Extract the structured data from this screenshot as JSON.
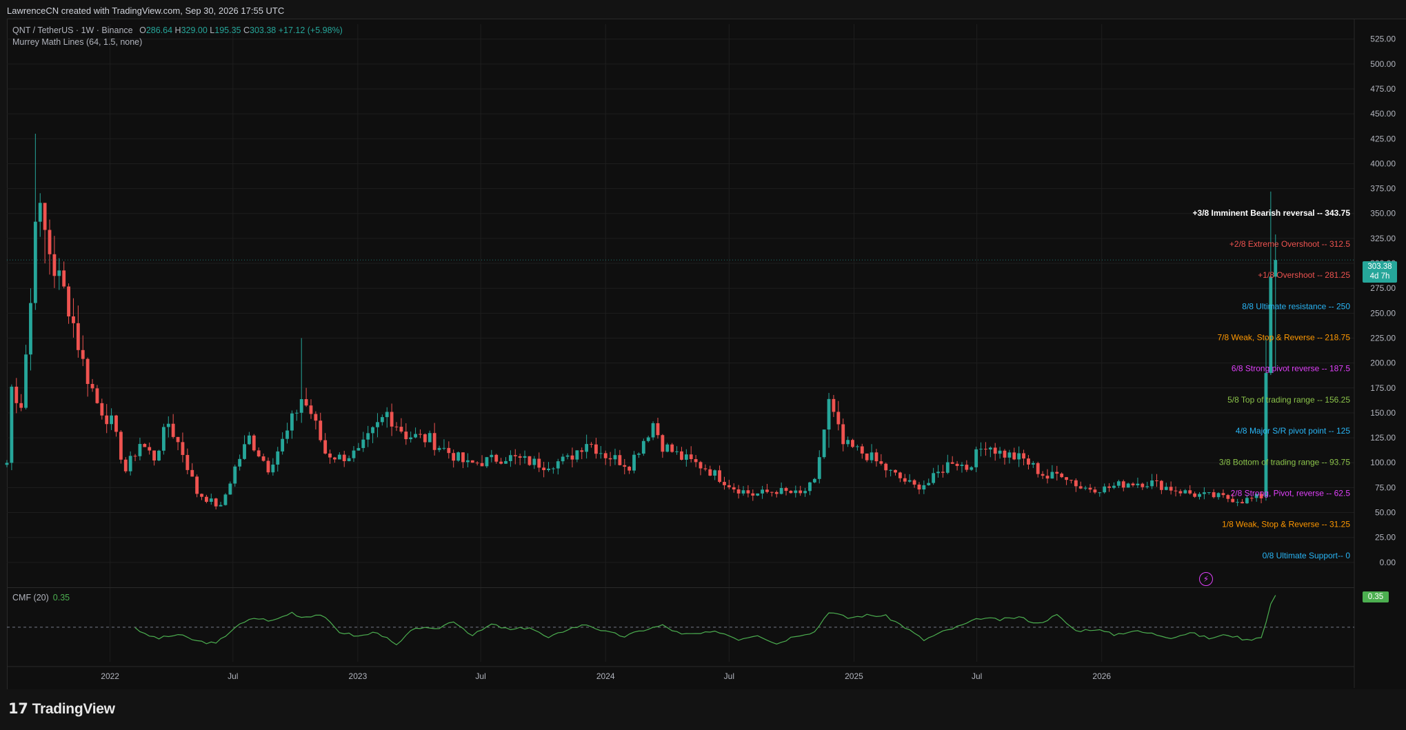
{
  "header": {
    "title": "LawrenceCN created with TradingView.com, Sep 30, 2026 17:55 UTC"
  },
  "legend": {
    "symbol": "QNT / TetherUS · 1W · Binance",
    "o_label": "O",
    "o_value": "286.64",
    "h_label": "H",
    "h_value": "329.00",
    "l_label": "L",
    "l_value": "195.35",
    "c_label": "C",
    "c_value": "303.38",
    "change": "+17.12 (+5.98%)",
    "indicator": "Murrey Math Lines (64, 1.5, none)"
  },
  "cmf": {
    "label": "CMF (20)",
    "value": "0.35",
    "tag": "0.35"
  },
  "price_tag": {
    "price": "303.38",
    "countdown": "4d 7h"
  },
  "branding": {
    "logo_mark": "𝟭𝟳",
    "logo_text": "TradingView"
  },
  "colors": {
    "up": "#26a69a",
    "down": "#ef5350",
    "cmf_line": "#4caf50",
    "background": "#0f0f0f",
    "grid": "#1e1e1e",
    "murrey_purple": "#e040fb"
  },
  "chart_data": {
    "type": "candlestick",
    "symbol": "QNT / TetherUS",
    "timeframe": "1W",
    "exchange": "Binance",
    "ylim": [
      -25,
      540
    ],
    "y_ticks": [
      "525.00",
      "500.00",
      "475.00",
      "450.00",
      "425.00",
      "400.00",
      "375.00",
      "350.00",
      "325.00",
      "300.00",
      "275.00",
      "250.00",
      "225.00",
      "200.00",
      "175.00",
      "150.00",
      "125.00",
      "100.00",
      "75.00",
      "50.00",
      "25.00",
      "0.00"
    ],
    "x_ticks": [
      {
        "label": "2022",
        "date": "2022-01-01"
      },
      {
        "label": "Jul",
        "date": "2022-07-01"
      },
      {
        "label": "2023",
        "date": "2023-01-01"
      },
      {
        "label": "Jul",
        "date": "2023-07-01"
      },
      {
        "label": "2024",
        "date": "2024-01-01"
      },
      {
        "label": "Jul",
        "date": "2024-07-01"
      },
      {
        "label": "2025",
        "date": "2025-01-01"
      },
      {
        "label": "Jul",
        "date": "2025-07-01"
      },
      {
        "label": "2026",
        "date": "2026-01-01"
      }
    ],
    "x_start": "2021-08-02",
    "x_end": "2027-01-04",
    "close_keypoints": [
      [
        "2021-08-02",
        100
      ],
      [
        "2021-08-09",
        175
      ],
      [
        "2021-08-23",
        160
      ],
      [
        "2021-09-06",
        260
      ],
      [
        "2021-09-13",
        360
      ],
      [
        "2021-09-27",
        330
      ],
      [
        "2021-10-11",
        295
      ],
      [
        "2021-11-01",
        260
      ],
      [
        "2021-11-22",
        200
      ],
      [
        "2021-12-13",
        160
      ],
      [
        "2022-01-03",
        140
      ],
      [
        "2022-01-24",
        92
      ],
      [
        "2022-02-14",
        120
      ],
      [
        "2022-03-07",
        105
      ],
      [
        "2022-03-28",
        140
      ],
      [
        "2022-04-18",
        110
      ],
      [
        "2022-05-09",
        70
      ],
      [
        "2022-06-13",
        55
      ],
      [
        "2022-07-04",
        95
      ],
      [
        "2022-07-25",
        125
      ],
      [
        "2022-08-22",
        95
      ],
      [
        "2022-09-19",
        130
      ],
      [
        "2022-10-10",
        165
      ],
      [
        "2022-10-24",
        150
      ],
      [
        "2022-11-14",
        110
      ],
      [
        "2022-12-05",
        105
      ],
      [
        "2023-01-02",
        110
      ],
      [
        "2023-02-13",
        150
      ],
      [
        "2023-03-13",
        128
      ],
      [
        "2023-04-17",
        123
      ],
      [
        "2023-06-12",
        98
      ],
      [
        "2023-08-07",
        106
      ],
      [
        "2023-10-02",
        98
      ],
      [
        "2023-11-06",
        103
      ],
      [
        "2023-12-04",
        122
      ],
      [
        "2024-01-01",
        108
      ],
      [
        "2024-02-05",
        98
      ],
      [
        "2024-03-11",
        140
      ],
      [
        "2024-03-25",
        118
      ],
      [
        "2024-04-22",
        105
      ],
      [
        "2024-05-27",
        95
      ],
      [
        "2024-07-08",
        75
      ],
      [
        "2024-08-05",
        68
      ],
      [
        "2024-09-09",
        72
      ],
      [
        "2024-10-14",
        68
      ],
      [
        "2024-11-04",
        80
      ],
      [
        "2024-11-25",
        160
      ],
      [
        "2024-12-16",
        118
      ],
      [
        "2025-01-20",
        108
      ],
      [
        "2025-02-24",
        90
      ],
      [
        "2025-03-31",
        76
      ],
      [
        "2025-04-21",
        80
      ],
      [
        "2025-05-26",
        103
      ],
      [
        "2025-06-16",
        95
      ],
      [
        "2025-07-14",
        120
      ],
      [
        "2025-08-04",
        110
      ],
      [
        "2025-09-08",
        103
      ],
      [
        "2025-10-13",
        85
      ],
      [
        "2025-11-03",
        90
      ],
      [
        "2025-12-01",
        75
      ],
      [
        "2026-01-05",
        74
      ],
      [
        "2026-02-09",
        80
      ],
      [
        "2026-03-16",
        80
      ],
      [
        "2026-04-13",
        74
      ],
      [
        "2026-05-18",
        68
      ],
      [
        "2026-06-22",
        66
      ],
      [
        "2026-07-27",
        62
      ],
      [
        "2026-08-24",
        66
      ],
      [
        "2026-08-31",
        190
      ],
      [
        "2026-09-07",
        286.64
      ],
      [
        "2026-09-14",
        303.38
      ]
    ],
    "last_candles": [
      {
        "date": "2026-08-31",
        "open": 66,
        "high": 225,
        "low": 62,
        "close": 190
      },
      {
        "date": "2026-09-07",
        "open": 190,
        "high": 372,
        "low": 188,
        "close": 286.64
      },
      {
        "date": "2026-09-14",
        "open": 286.64,
        "high": 329.0,
        "low": 195.35,
        "close": 303.38
      }
    ],
    "highlights": [
      {
        "date": "2021-09-13",
        "high": 430,
        "low": 320
      },
      {
        "date": "2021-09-27",
        "high": 355,
        "low": 300
      },
      {
        "date": "2022-10-10",
        "high": 225,
        "low": 140
      },
      {
        "date": "2024-11-25",
        "high": 170,
        "low": 115
      }
    ],
    "murrey_lines": [
      {
        "label": "+3/8 Imminent Bearish reversal --  343.75",
        "value": 343.75,
        "color": "#ffffff",
        "bold": true
      },
      {
        "label": "+2/8 Extreme Overshoot --  312.5",
        "value": 312.5,
        "color": "#ef5350"
      },
      {
        "label": "+1/8 Overshoot --  281.25",
        "value": 281.25,
        "color": "#ef5350"
      },
      {
        "label": "8/8 Ultimate resistance --  250",
        "value": 250,
        "color": "#29b6f6"
      },
      {
        "label": "7/8 Weak, Stop & Reverse --  218.75",
        "value": 218.75,
        "color": "#ff9800"
      },
      {
        "label": "6/8 Strong pivot reverse --  187.5",
        "value": 187.5,
        "color": "#e040fb"
      },
      {
        "label": "5/8 Top of trading range --  156.25",
        "value": 156.25,
        "color": "#8bc34a"
      },
      {
        "label": "4/8 Major S/R pivot point --  125",
        "value": 125,
        "color": "#29b6f6"
      },
      {
        "label": "3/8 Bottom of trading range --  93.75",
        "value": 93.75,
        "color": "#8bc34a"
      },
      {
        "label": "2/8 Strong, Pivot, reverse --  62.5",
        "value": 62.5,
        "color": "#e040fb"
      },
      {
        "label": "1/8 Weak, Stop & Reverse --  31.25",
        "value": 31.25,
        "color": "#ff9800"
      },
      {
        "label": "0/8 Ultimate Support--  0",
        "value": 0,
        "color": "#29b6f6"
      }
    ],
    "cmf_series": {
      "name": "CMF (20)",
      "zero_line": 0,
      "ylim": [
        -0.3,
        0.35
      ],
      "keypoints": [
        [
          "2022-02-07",
          0
        ],
        [
          "2022-02-21",
          -0.08
        ],
        [
          "2022-03-14",
          -0.12
        ],
        [
          "2022-04-11",
          -0.08
        ],
        [
          "2022-05-09",
          -0.15
        ],
        [
          "2022-06-06",
          -0.18
        ],
        [
          "2022-07-04",
          0.0
        ],
        [
          "2022-08-01",
          0.1
        ],
        [
          "2022-08-29",
          0.07
        ],
        [
          "2022-09-26",
          0.16
        ],
        [
          "2022-10-10",
          0.11
        ],
        [
          "2022-11-07",
          0.14
        ],
        [
          "2022-12-05",
          -0.05
        ],
        [
          "2023-01-02",
          -0.1
        ],
        [
          "2023-01-30",
          -0.05
        ],
        [
          "2023-02-27",
          -0.2
        ],
        [
          "2023-03-27",
          0.0
        ],
        [
          "2023-04-24",
          -0.03
        ],
        [
          "2023-05-22",
          0.07
        ],
        [
          "2023-06-19",
          -0.09
        ],
        [
          "2023-07-17",
          0.03
        ],
        [
          "2023-08-14",
          -0.03
        ],
        [
          "2023-09-11",
          0.0
        ],
        [
          "2023-10-09",
          -0.12
        ],
        [
          "2023-11-06",
          -0.02
        ],
        [
          "2023-12-04",
          0.03
        ],
        [
          "2024-01-01",
          -0.05
        ],
        [
          "2024-01-29",
          -0.1
        ],
        [
          "2024-02-26",
          -0.03
        ],
        [
          "2024-03-25",
          0.02
        ],
        [
          "2024-04-22",
          -0.08
        ],
        [
          "2024-05-20",
          -0.07
        ],
        [
          "2024-06-17",
          -0.05
        ],
        [
          "2024-07-15",
          -0.13
        ],
        [
          "2024-08-12",
          -0.08
        ],
        [
          "2024-09-09",
          -0.18
        ],
        [
          "2024-10-07",
          -0.09
        ],
        [
          "2024-11-04",
          -0.05
        ],
        [
          "2024-11-25",
          0.17
        ],
        [
          "2024-12-23",
          0.1
        ],
        [
          "2025-01-20",
          0.13
        ],
        [
          "2025-02-17",
          0.12
        ],
        [
          "2025-03-17",
          0.0
        ],
        [
          "2025-04-14",
          -0.14
        ],
        [
          "2025-05-12",
          -0.05
        ],
        [
          "2025-06-09",
          0.02
        ],
        [
          "2025-07-07",
          0.1
        ],
        [
          "2025-08-04",
          0.08
        ],
        [
          "2025-09-01",
          0.11
        ],
        [
          "2025-09-29",
          0.04
        ],
        [
          "2025-10-27",
          0.13
        ],
        [
          "2025-11-24",
          -0.04
        ],
        [
          "2025-12-22",
          -0.02
        ],
        [
          "2026-01-19",
          -0.08
        ],
        [
          "2026-02-16",
          -0.04
        ],
        [
          "2026-03-16",
          -0.07
        ],
        [
          "2026-04-13",
          -0.11
        ],
        [
          "2026-05-11",
          -0.06
        ],
        [
          "2026-06-08",
          -0.12
        ],
        [
          "2026-07-06",
          -0.08
        ],
        [
          "2026-08-03",
          -0.14
        ],
        [
          "2026-08-24",
          -0.1
        ],
        [
          "2026-08-31",
          0.05
        ],
        [
          "2026-09-07",
          0.25
        ],
        [
          "2026-09-14",
          0.35
        ]
      ]
    }
  }
}
